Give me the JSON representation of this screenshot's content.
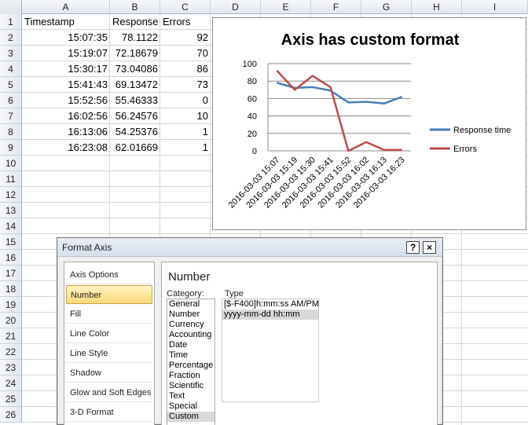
{
  "columns": [
    "A",
    "B",
    "C",
    "D",
    "E",
    "F",
    "G",
    "H",
    "I"
  ],
  "rows": [
    "1",
    "2",
    "3",
    "4",
    "5",
    "6",
    "7",
    "8",
    "9",
    "10",
    "11",
    "12",
    "13",
    "14",
    "15",
    "16",
    "17",
    "18",
    "19",
    "20",
    "21",
    "22",
    "23",
    "24",
    "25",
    "26"
  ],
  "table": {
    "headers": [
      "Timestamp",
      "Response",
      "Errors"
    ],
    "cells": [
      [
        "15:07:35",
        "78.1122",
        "92"
      ],
      [
        "15:19:07",
        "72.18679",
        "70"
      ],
      [
        "15:30:17",
        "73.04086",
        "86"
      ],
      [
        "15:41:43",
        "69.13472",
        "73"
      ],
      [
        "15:52:56",
        "55.46333",
        "0"
      ],
      [
        "16:02:56",
        "56.24576",
        "10"
      ],
      [
        "16:13:06",
        "54.25376",
        "1"
      ],
      [
        "16:23:08",
        "62.01669",
        "1"
      ]
    ]
  },
  "chart_data": {
    "type": "line",
    "title": "Axis has custom format",
    "categories": [
      "2016-03-03 15:07",
      "2016-03-03 15:19",
      "2016-03-03 15:30",
      "2016-03-03 15:41",
      "2016-03-03 15:52",
      "2016-03-03 16:02",
      "2016-03-03 16:13",
      "2016-03-03 16:23"
    ],
    "series": [
      {
        "name": "Response time",
        "values": [
          78.1122,
          72.18679,
          73.04086,
          69.13472,
          55.46333,
          56.24576,
          54.25376,
          62.01669
        ],
        "color": "#4a7ebb"
      },
      {
        "name": "Errors",
        "values": [
          92,
          70,
          86,
          73,
          0,
          10,
          1,
          1
        ],
        "color": "#be4b48"
      }
    ],
    "y_ticks": [
      "0",
      "20",
      "40",
      "60",
      "80",
      "100"
    ],
    "ylim": [
      0,
      100
    ],
    "grid": true,
    "legend": "right"
  },
  "dialog": {
    "title": "Format Axis",
    "help_label": "?",
    "close_label": "×",
    "nav": [
      "Axis Options",
      "Number",
      "Fill",
      "Line Color",
      "Line Style",
      "Shadow",
      "Glow and Soft Edges",
      "3-D Format"
    ],
    "selected_nav": "Number",
    "section_title": "Number",
    "category_label": "Category:",
    "type_label": "Type",
    "categories": [
      "General",
      "Number",
      "Currency",
      "Accounting",
      "Date",
      "Time",
      "Percentage",
      "Fraction",
      "Scientific",
      "Text",
      "Special",
      "Custom"
    ],
    "selected_category": "Custom",
    "types": [
      "[$-F400]h:mm:ss AM/PM",
      "yyyy-mm-dd hh:mm"
    ],
    "selected_type": "yyyy-mm-dd hh:mm"
  }
}
